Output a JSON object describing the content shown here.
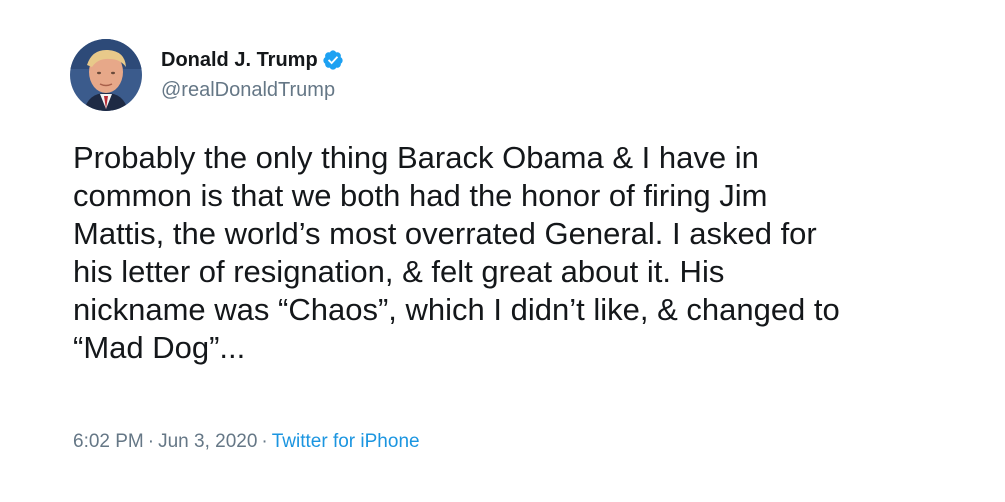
{
  "tweet": {
    "author": {
      "display_name": "Donald J. Trump",
      "handle": "@realDonaldTrump",
      "verified": true,
      "verified_icon": "verified-badge-icon",
      "avatar_icon": "profile-photo"
    },
    "body_lines": [
      "Probably the only thing Barack Obama & I have in",
      "common is that we both had the honor of firing Jim",
      "Mattis, the world’s most overrated General. I asked for",
      "his letter of resignation, & felt great about it. His",
      "nickname was “Chaos”, which I didn’t like, & changed to",
      "“Mad Dog”..."
    ],
    "meta": {
      "time": "6:02 PM",
      "separator": "·",
      "date": "Jun 3, 2020",
      "source": "Twitter for iPhone"
    }
  },
  "colors": {
    "text": "#14171a",
    "secondary": "#657786",
    "link": "#1b95e0",
    "verified_badge": "#1da1f2",
    "background": "#ffffff"
  }
}
